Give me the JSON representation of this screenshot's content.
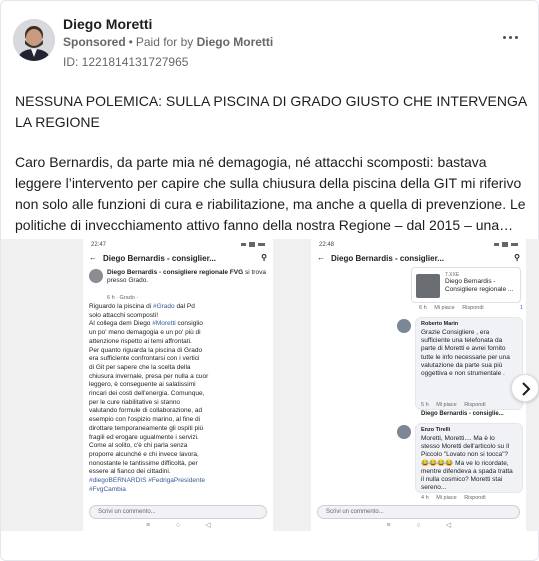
{
  "advertiser": {
    "name": "Diego Moretti",
    "sponsored_label": "Sponsored",
    "paid_for_label": "Paid for by",
    "paid_for_name": "Diego Moretti",
    "library_id": "ID: 1221814131727965"
  },
  "post": {
    "headline": "NESSUNA POLEMICA: SULLA PISCINA DI GRADO GIUSTO CHE INTERVENGA LA REGIONE",
    "body": "Caro Bernardis, da parte mia né demagogia, né attacchi scomposti: bastava leggere l’intervento per capire che sulla chiusura della piscina della GIT mi riferivo non solo alle funzioni di cura e riabilitazione, ma anche a quella di prevenzione. Le politiche di invecchiamento attivo fanno della nostra Regione – dal 2015 – una…"
  },
  "carousel": {
    "card1": {
      "time": "22:47",
      "nav_title": "Diego Bernardis - consiglier...",
      "author_name": "Diego Bernardis - consigliere regionale FVG",
      "author_suffix": "si trova presso Grado.",
      "meta": "6 h · Grado ·",
      "text_lines": [
        "Riguardo la piscina di #Grado dal Pd",
        "solo attacchi scomposti!",
        "Al collega dem Diego #Moretti consiglio",
        "un po' meno demagogia e un po' più di",
        "attenzione rispetto ai temi affrontati.",
        "Per quanto riguarda la piscina di Grado",
        "era sufficiente confrontarsi con i vertici",
        "di Git per sapere che la scelta della",
        "chiusura invernale, presa per nulla a cuor",
        "leggero, è conseguente ai salatissimi",
        "rincari dei costi dell'energia. Comunque,",
        "per le cure riabilitative si stanno",
        "valutando formule di collaborazione, ad",
        "esempio con l'ospizio marino, al fine di",
        "dirottare temporaneamente gli ospiti più",
        "fragili ed erogare ugualmente i servizi.",
        "Come al solito, c'è chi parla senza",
        "proporre alcunché e chi invece lavora,",
        "nonostante le tantissime difficoltà, per",
        "essere al fianco dei cittadini.",
        "#diegoBERNARDIS #FedrigaPresidente",
        "#FvgCambia"
      ],
      "comment_placeholder": "Scrivi un commento..."
    },
    "card2": {
      "time": "22:48",
      "nav_title": "Diego Bernardis - consiglier...",
      "post_meta": "7.XXE",
      "post_author": "Diego Bernardis - Consigliere regionale ...",
      "post_actions": [
        "6 h",
        "Mi piace",
        "Rispondi"
      ],
      "post_reactions": "1",
      "reply1": {
        "author": "Roberto Marin",
        "lines": [
          "Grazie Consigliere , era",
          "sufficiente una telefonata da",
          "parte di Moretti e avrei fornito",
          "tutte le info necessarie per una",
          "valutazione da parte sua più",
          "oggettiva e non strumentale ."
        ],
        "actions": [
          "5 h",
          "Mi piace",
          "Rispondi"
        ]
      },
      "sub_reply_author": "Diego Bernardis - consiglie...",
      "reply2": {
        "author": "Enzo Tirelli",
        "lines": [
          "Moretti, Moretti.... Ma è lo",
          "stesso Moretti dell'articolo su Il",
          "Piccolo \"Lovato non si tocca\"?",
          "😂😂😂😂 Ma ve lo ricordate,",
          "mentre difendeva a spada tratta",
          "il nulla cosmico? Moretti stai",
          "sereno..."
        ],
        "actions": [
          "4 h",
          "Mi piace",
          "Rispondi"
        ]
      },
      "comment_placeholder": "Scrivi un commento..."
    },
    "nav_glyphs": [
      "≡",
      "○",
      "◁"
    ]
  },
  "colors": {
    "text": "#1c1e21",
    "secondary": "#65676b",
    "hashtag": "#385898",
    "border": "#e4e6eb"
  }
}
